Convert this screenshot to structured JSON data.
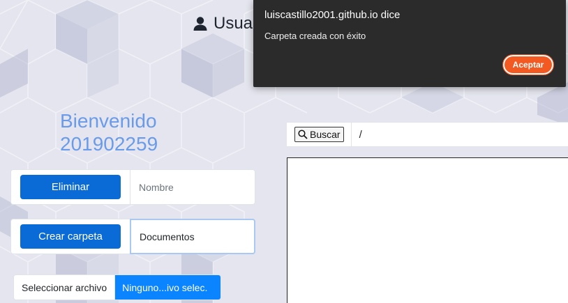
{
  "header": {
    "title_partial": "Usua"
  },
  "welcome": {
    "line1": "Bienvenido",
    "line2": "201902259"
  },
  "delete_row": {
    "button_label": "Eliminar",
    "input_placeholder": "Nombre"
  },
  "create_row": {
    "button_label": "Crear carpeta",
    "input_value": "Documentos"
  },
  "file_input": {
    "button_label": "Seleccionar archivo",
    "status_text": "Ninguno...ivo selec."
  },
  "search": {
    "button_label": "Buscar",
    "path": "/"
  },
  "dialog": {
    "title": "luiscastillo2001.github.io dice",
    "message": "Carpeta creada con éxito",
    "ok_label": "Aceptar"
  },
  "colors": {
    "accent": "#0a6bd6",
    "welcome_text": "#6a9bea",
    "file_status_bg": "#0a84ff",
    "dialog_bg": "#2b2b2b",
    "dialog_button": "#f25a22"
  }
}
